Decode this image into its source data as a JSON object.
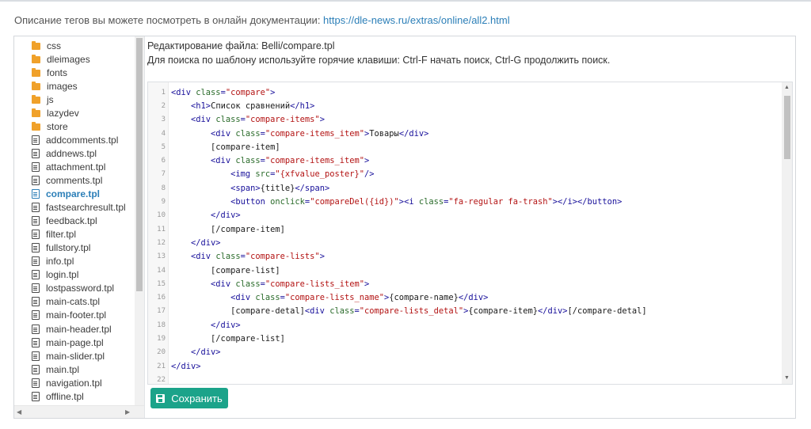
{
  "doc_note": {
    "text": "Описание тегов вы можете посмотреть в онлайн документации: ",
    "link": "https://dle-news.ru/extras/online/all2.html"
  },
  "editor_header": {
    "title": "Редактирование файла: Belli/compare.tpl",
    "hint": "Для поиска по шаблону используйте горячие клавиши: Ctrl-F начать поиск, Ctrl-G продолжить поиск."
  },
  "file_tree": {
    "items": [
      {
        "label": "css",
        "type": "folder"
      },
      {
        "label": "dleimages",
        "type": "folder"
      },
      {
        "label": "fonts",
        "type": "folder"
      },
      {
        "label": "images",
        "type": "folder"
      },
      {
        "label": "js",
        "type": "folder"
      },
      {
        "label": "lazydev",
        "type": "folder"
      },
      {
        "label": "store",
        "type": "folder"
      },
      {
        "label": "addcomments.tpl",
        "type": "file"
      },
      {
        "label": "addnews.tpl",
        "type": "file"
      },
      {
        "label": "attachment.tpl",
        "type": "file"
      },
      {
        "label": "comments.tpl",
        "type": "file"
      },
      {
        "label": "compare.tpl",
        "type": "file",
        "active": true
      },
      {
        "label": "fastsearchresult.tpl",
        "type": "file"
      },
      {
        "label": "feedback.tpl",
        "type": "file"
      },
      {
        "label": "filter.tpl",
        "type": "file"
      },
      {
        "label": "fullstory.tpl",
        "type": "file"
      },
      {
        "label": "info.tpl",
        "type": "file"
      },
      {
        "label": "login.tpl",
        "type": "file"
      },
      {
        "label": "lostpassword.tpl",
        "type": "file"
      },
      {
        "label": "main-cats.tpl",
        "type": "file"
      },
      {
        "label": "main-footer.tpl",
        "type": "file"
      },
      {
        "label": "main-header.tpl",
        "type": "file"
      },
      {
        "label": "main-page.tpl",
        "type": "file"
      },
      {
        "label": "main-slider.tpl",
        "type": "file"
      },
      {
        "label": "main.tpl",
        "type": "file"
      },
      {
        "label": "navigation.tpl",
        "type": "file"
      },
      {
        "label": "offline.tpl",
        "type": "file"
      }
    ]
  },
  "code": {
    "lines": [
      {
        "n": "1",
        "tokens": [
          [
            "t",
            "<div "
          ],
          [
            "a",
            "class"
          ],
          [
            "t",
            "="
          ],
          [
            "s",
            "\"compare\""
          ],
          [
            "t",
            ">"
          ]
        ]
      },
      {
        "n": "2",
        "tokens": [
          [
            "p",
            "    "
          ],
          [
            "t",
            "<h1>"
          ],
          [
            "p",
            "Список сравнений"
          ],
          [
            "t",
            "</h1>"
          ]
        ]
      },
      {
        "n": "3",
        "tokens": [
          [
            "p",
            "    "
          ],
          [
            "t",
            "<div "
          ],
          [
            "a",
            "class"
          ],
          [
            "t",
            "="
          ],
          [
            "s",
            "\"compare-items\""
          ],
          [
            "t",
            ">"
          ]
        ]
      },
      {
        "n": "4",
        "tokens": [
          [
            "p",
            "        "
          ],
          [
            "t",
            "<div "
          ],
          [
            "a",
            "class"
          ],
          [
            "t",
            "="
          ],
          [
            "s",
            "\"compare-items_item\""
          ],
          [
            "t",
            ">"
          ],
          [
            "p",
            "Товары"
          ],
          [
            "t",
            "</div>"
          ]
        ]
      },
      {
        "n": "5",
        "tokens": [
          [
            "p",
            "        [compare-item]"
          ]
        ]
      },
      {
        "n": "6",
        "tokens": [
          [
            "p",
            "        "
          ],
          [
            "t",
            "<div "
          ],
          [
            "a",
            "class"
          ],
          [
            "t",
            "="
          ],
          [
            "s",
            "\"compare-items_item\""
          ],
          [
            "t",
            ">"
          ]
        ]
      },
      {
        "n": "7",
        "tokens": [
          [
            "p",
            "            "
          ],
          [
            "t",
            "<img "
          ],
          [
            "a",
            "src"
          ],
          [
            "t",
            "="
          ],
          [
            "s",
            "\"{xfvalue_poster}\""
          ],
          [
            "t",
            "/>"
          ]
        ]
      },
      {
        "n": "8",
        "tokens": [
          [
            "p",
            "            "
          ],
          [
            "t",
            "<span>"
          ],
          [
            "p",
            "{title}"
          ],
          [
            "t",
            "</span>"
          ]
        ]
      },
      {
        "n": "9",
        "tokens": [
          [
            "p",
            "            "
          ],
          [
            "t",
            "<button "
          ],
          [
            "a",
            "onclick"
          ],
          [
            "t",
            "="
          ],
          [
            "s",
            "\"compareDel({id})\""
          ],
          [
            "t",
            ">"
          ],
          [
            "t",
            "<i "
          ],
          [
            "a",
            "class"
          ],
          [
            "t",
            "="
          ],
          [
            "s",
            "\"fa-regular fa-trash\""
          ],
          [
            "t",
            "></i></button>"
          ]
        ]
      },
      {
        "n": "10",
        "tokens": [
          [
            "p",
            "        "
          ],
          [
            "t",
            "</div>"
          ]
        ]
      },
      {
        "n": "11",
        "tokens": [
          [
            "p",
            "        [/compare-item]"
          ]
        ]
      },
      {
        "n": "12",
        "tokens": [
          [
            "p",
            "    "
          ],
          [
            "t",
            "</div>"
          ]
        ]
      },
      {
        "n": "13",
        "tokens": [
          [
            "p",
            "    "
          ],
          [
            "t",
            "<div "
          ],
          [
            "a",
            "class"
          ],
          [
            "t",
            "="
          ],
          [
            "s",
            "\"compare-lists\""
          ],
          [
            "t",
            ">"
          ]
        ]
      },
      {
        "n": "14",
        "tokens": [
          [
            "p",
            "        [compare-list]"
          ]
        ]
      },
      {
        "n": "15",
        "tokens": [
          [
            "p",
            "        "
          ],
          [
            "t",
            "<div "
          ],
          [
            "a",
            "class"
          ],
          [
            "t",
            "="
          ],
          [
            "s",
            "\"compare-lists_item\""
          ],
          [
            "t",
            ">"
          ]
        ]
      },
      {
        "n": "16",
        "tokens": [
          [
            "p",
            "            "
          ],
          [
            "t",
            "<div "
          ],
          [
            "a",
            "class"
          ],
          [
            "t",
            "="
          ],
          [
            "s",
            "\"compare-lists_name\""
          ],
          [
            "t",
            ">"
          ],
          [
            "p",
            "{compare-name}"
          ],
          [
            "t",
            "</div>"
          ]
        ]
      },
      {
        "n": "17",
        "tokens": [
          [
            "p",
            "            [compare-detal]"
          ],
          [
            "t",
            "<div "
          ],
          [
            "a",
            "class"
          ],
          [
            "t",
            "="
          ],
          [
            "s",
            "\"compare-lists_detal\""
          ],
          [
            "t",
            ">"
          ],
          [
            "p",
            "{compare-item}"
          ],
          [
            "t",
            "</div>"
          ],
          [
            "p",
            "[/compare-detal]"
          ]
        ]
      },
      {
        "n": "18",
        "tokens": [
          [
            "p",
            "        "
          ],
          [
            "t",
            "</div>"
          ]
        ]
      },
      {
        "n": "19",
        "tokens": [
          [
            "p",
            "        [/compare-list]"
          ]
        ]
      },
      {
        "n": "20",
        "tokens": [
          [
            "p",
            "    "
          ],
          [
            "t",
            "</div>"
          ]
        ]
      },
      {
        "n": "21",
        "tokens": [
          [
            "t",
            "</div>"
          ]
        ]
      },
      {
        "n": "22",
        "tokens": []
      }
    ]
  },
  "save_button": {
    "label": "Сохранить",
    "icon": "floppy-disk-icon"
  },
  "colors": {
    "accent": "#1ba38a",
    "link": "#2c7fb8",
    "folder": "#f0a12a"
  }
}
